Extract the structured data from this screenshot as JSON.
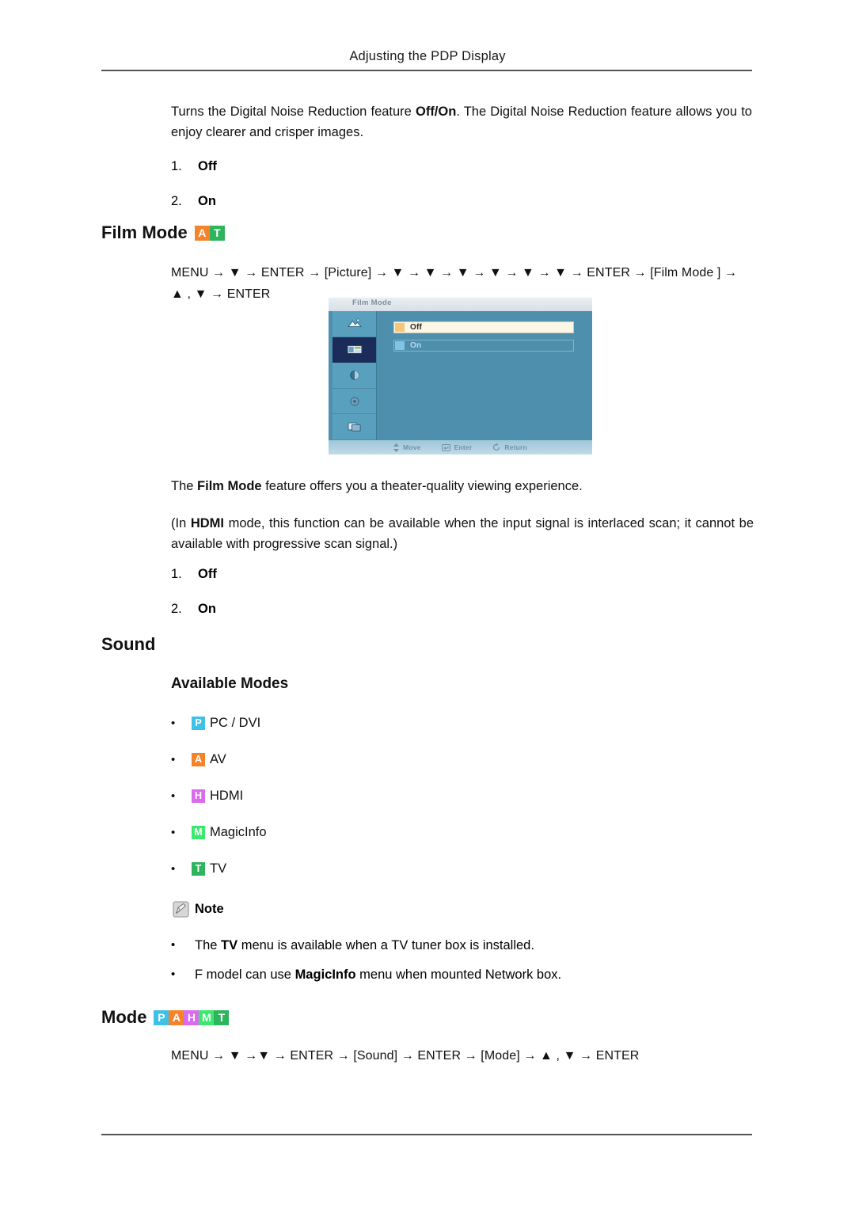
{
  "header": {
    "title": "Adjusting the PDP Display"
  },
  "intro": {
    "text_before": "Turns the Digital Noise Reduction feature ",
    "bold_1": "Off/On",
    "text_after": ". The Digital Noise Reduction feature allows you to enjoy clearer and crisper images."
  },
  "dnr_options": [
    {
      "num": "1.",
      "label": "Off"
    },
    {
      "num": "2.",
      "label": "On"
    }
  ],
  "film_mode": {
    "heading": "Film Mode",
    "badges": [
      {
        "letter": "A",
        "color": "#F5832A",
        "name": "AV"
      },
      {
        "letter": "T",
        "color": "#2DB45C",
        "name": "TV"
      }
    ],
    "nav_path": {
      "line1": "MENU → ▼ → ENTER → [Picture] → ▼ → ▼ → ▼ → ▼ → ▼ → ▼ → ENTER → [Film Mode ] →",
      "line2": "▲ , ▼ → ENTER",
      "tokens": [
        "MENU",
        "ENTER",
        "[Picture]",
        "ENTER",
        "[Film Mode ]",
        "ENTER"
      ]
    },
    "description_before": "The ",
    "description_bold": "Film Mode",
    "description_after": " feature offers you a theater-quality viewing experience.",
    "hdmi_note_before": "(In ",
    "hdmi_note_bold": "HDMI",
    "hdmi_note_after": " mode, this function can be available when the input signal is interlaced scan; it cannot be available with progressive scan signal.)",
    "options": [
      {
        "num": "1.",
        "label": "Off"
      },
      {
        "num": "2.",
        "label": "On"
      }
    ]
  },
  "osd": {
    "title": "Film Mode",
    "rows": [
      {
        "label": "Off",
        "selected": true
      },
      {
        "label": "On",
        "selected": false
      }
    ],
    "footer": [
      {
        "label": "Move",
        "icon": "updown-arrow-icon"
      },
      {
        "label": "Enter",
        "icon": "enter-key-icon"
      },
      {
        "label": "Return",
        "icon": "return-arrow-icon"
      }
    ],
    "sidebar_icons": [
      "picture-icon",
      "film-icon",
      "sound-icon",
      "setup-icon",
      "multicontrol-icon"
    ],
    "selected_sidebar_index": 1
  },
  "sound": {
    "heading": "Sound",
    "available_modes_heading": "Available Modes",
    "modes": [
      {
        "letter": "P",
        "label": "PC / DVI",
        "color": "#3FC0E8"
      },
      {
        "letter": "A",
        "label": "AV",
        "color": "#F5832A"
      },
      {
        "letter": "H",
        "label": "HDMI",
        "color": "#D96BEE"
      },
      {
        "letter": "M",
        "label": "MagicInfo",
        "color": "#3DE870"
      },
      {
        "letter": "T",
        "label": "TV",
        "color": "#2DB45C"
      }
    ],
    "note": {
      "label": "Note",
      "items": [
        {
          "before": "The ",
          "bold": "TV",
          "after": " menu is available when a TV tuner box is installed."
        },
        {
          "before": "F model can use ",
          "bold": "MagicInfo",
          "after": " menu when mounted Network box."
        }
      ]
    }
  },
  "mode_section": {
    "heading": "Mode",
    "badges": [
      {
        "letter": "P",
        "color": "#3FC0E8"
      },
      {
        "letter": "A",
        "color": "#F5832A"
      },
      {
        "letter": "H",
        "color": "#D96BEE"
      },
      {
        "letter": "M",
        "color": "#3DE870"
      },
      {
        "letter": "T",
        "color": "#2DB45C"
      }
    ],
    "nav_path": "MENU → ▼ →▼ → ENTER → [Sound] → ENTER → [Mode] → ▲ , ▼ → ENTER"
  }
}
